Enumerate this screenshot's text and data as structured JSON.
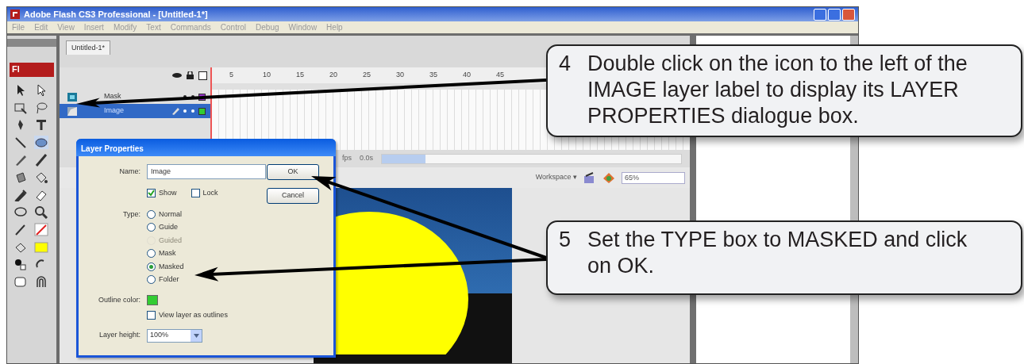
{
  "window": {
    "title": "Adobe Flash CS3 Professional - [Untitled-1*]"
  },
  "menu": [
    "File",
    "Edit",
    "View",
    "Insert",
    "Modify",
    "Text",
    "Commands",
    "Control",
    "Debug",
    "Window",
    "Help"
  ],
  "tools_logo": "Fl",
  "document_tab": {
    "label": "Untitled-1*",
    "selected": true
  },
  "timeline": {
    "frame_numbers": [
      "5",
      "10",
      "15",
      "20",
      "25",
      "30",
      "35",
      "40",
      "45"
    ],
    "layers": [
      {
        "name": "Mask",
        "kind": "mask",
        "selected": false,
        "color": "#9933cc"
      },
      {
        "name": "Image",
        "kind": "masked",
        "selected": true,
        "color": "#33cc33"
      }
    ],
    "fps": "fps",
    "time": "0.0s"
  },
  "edit_bar": {
    "workspace": "Workspace ▾",
    "zoom": "65%"
  },
  "dialog": {
    "title": "Layer Properties",
    "name_label": "Name:",
    "name_value": "Image",
    "ok": "OK",
    "cancel": "Cancel",
    "checks": [
      {
        "label": "Show",
        "checked": true
      },
      {
        "label": "Lock",
        "checked": false
      }
    ],
    "type_label": "Type:",
    "types": [
      {
        "label": "Normal",
        "selected": false,
        "disabled": false
      },
      {
        "label": "Guide",
        "selected": false,
        "disabled": false
      },
      {
        "label": "Guided",
        "selected": false,
        "disabled": true
      },
      {
        "label": "Mask",
        "selected": false,
        "disabled": false
      },
      {
        "label": "Masked",
        "selected": true,
        "disabled": false
      },
      {
        "label": "Folder",
        "selected": false,
        "disabled": false
      }
    ],
    "outline_label": "Outline color:",
    "outlines_check": {
      "label": "View layer as outlines",
      "checked": false
    },
    "height_label": "Layer height:",
    "height_value": "100%"
  },
  "callouts": [
    {
      "number": "4",
      "text": "Double click on the icon to the left of the IMAGE layer label to display its LAYER PROPERTIES dialogue box."
    },
    {
      "number": "5",
      "text": "Set the TYPE box to MASKED and click on OK."
    }
  ]
}
